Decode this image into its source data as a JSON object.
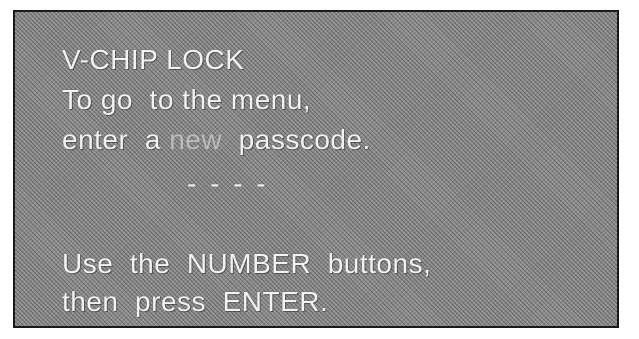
{
  "screen": {
    "title": "V-CHIP LOCK",
    "prompt_line1": "To go  to the menu,",
    "prompt_line2_before": "enter  a ",
    "prompt_line2_highlight": "new",
    "prompt_line2_after": "  passcode.",
    "passcode_placeholder": "- - - -",
    "hint_line1": "Use  the  NUMBER  buttons,",
    "hint_line2": "then  press  ENTER."
  },
  "colors": {
    "background": "#8c8c8c",
    "text": "#f2f2f2",
    "highlight_text": "#bdbdbd",
    "border": "#1a1a1a"
  }
}
